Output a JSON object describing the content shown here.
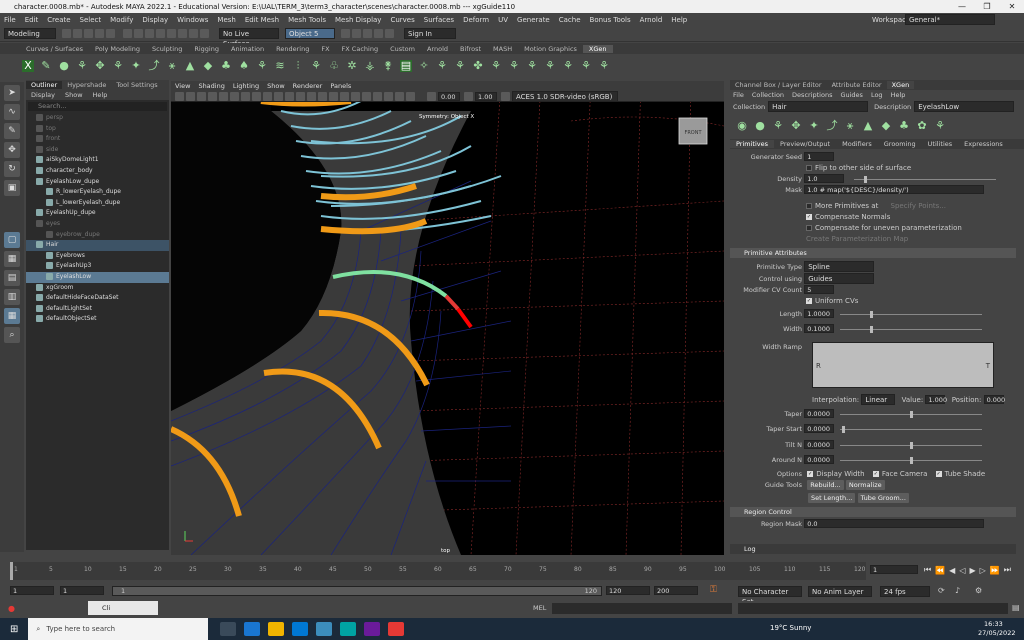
{
  "window": {
    "title": "character.0008.mb* - Autodesk MAYA 2022.1 - Educational Version: E:\\UAL\\TERM_3\\term3_character\\scenes\\character.0008.mb  ---  xgGuide110",
    "min": "—",
    "max": "❐",
    "close": "✕"
  },
  "menubar": [
    "File",
    "Edit",
    "Create",
    "Select",
    "Modify",
    "Display",
    "Windows",
    "Mesh",
    "Edit Mesh",
    "Mesh Tools",
    "Mesh Display",
    "Curves",
    "Surfaces",
    "Deform",
    "UV",
    "Generate",
    "Cache",
    "Bonus Tools",
    "Arnold",
    "Help"
  ],
  "workspace": {
    "label": "Workspace:",
    "value": "General*"
  },
  "statusline": {
    "mode": "Modeling",
    "live": "No Live Surface",
    "object": "Object 5",
    "signin": "Sign In"
  },
  "shelf_tabs": [
    "Curves / Surfaces",
    "Poly Modeling",
    "Sculpting",
    "Rigging",
    "Animation",
    "Rendering",
    "FX",
    "FX Caching",
    "Custom",
    "Arnold",
    "Bifrost",
    "MASH",
    "Motion Graphics",
    "XGen"
  ],
  "shelf_active": "XGen",
  "outliner": {
    "tabs": [
      "Outliner",
      "Hypershade",
      "Tool Settings"
    ],
    "menu": [
      "Display",
      "Show",
      "Help"
    ],
    "search_placeholder": "Search...",
    "rows": [
      {
        "label": "persp",
        "style": "dim",
        "indent": 1
      },
      {
        "label": "top",
        "style": "dim",
        "indent": 1
      },
      {
        "label": "front",
        "style": "dim",
        "indent": 1
      },
      {
        "label": "side",
        "style": "dim",
        "indent": 1
      },
      {
        "label": "aiSkyDomeLight1",
        "style": "",
        "indent": 1
      },
      {
        "label": "character_body",
        "style": "",
        "indent": 1
      },
      {
        "label": "EyelashLow_dupe",
        "style": "",
        "indent": 1
      },
      {
        "label": "R_lowerEyelash_dupe",
        "style": "",
        "indent": 2
      },
      {
        "label": "L_lowerEyelash_dupe",
        "style": "",
        "indent": 2
      },
      {
        "label": "EyelashUp_dupe",
        "style": "",
        "indent": 1
      },
      {
        "label": "eyes",
        "style": "dim",
        "indent": 1
      },
      {
        "label": "eyebrow_dupe",
        "style": "dim",
        "indent": 2
      },
      {
        "label": "Hair",
        "style": "sel2",
        "indent": 1
      },
      {
        "label": "Eyebrows",
        "style": "",
        "indent": 2
      },
      {
        "label": "EyelashUp3",
        "style": "",
        "indent": 2
      },
      {
        "label": "EyelashLow",
        "style": "sel",
        "indent": 2
      },
      {
        "label": "xgGroom",
        "style": "",
        "indent": 1
      },
      {
        "label": "defaultHideFaceDataSet",
        "style": "",
        "indent": 1
      },
      {
        "label": "defaultLightSet",
        "style": "",
        "indent": 1
      },
      {
        "label": "defaultObjectSet",
        "style": "",
        "indent": 1
      }
    ]
  },
  "viewport": {
    "menu": [
      "View",
      "Shading",
      "Lighting",
      "Show",
      "Renderer",
      "Panels"
    ],
    "symmetry": "Symmetry: Object X",
    "camera": "top",
    "cube": "FRONT",
    "val1": "0.00",
    "val2": "1.00",
    "colorspace": "ACES 1.0 SDR-video (sRGB)"
  },
  "right": {
    "tabs": [
      "Channel Box / Layer Editor",
      "Attribute Editor",
      "XGen"
    ],
    "active_tab": "XGen",
    "menu": [
      "File",
      "Collection",
      "Descriptions",
      "Guides",
      "Log",
      "Help"
    ],
    "collection_label": "Collection",
    "collection": "Hair",
    "description_label": "Description",
    "description": "EyelashLow",
    "subtabs": [
      "Primitives",
      "Preview/Output",
      "Modifiers",
      "Grooming",
      "Utilities",
      "Expressions"
    ],
    "generator_seed_label": "Generator Seed",
    "generator_seed": "1",
    "flip_label": "Flip to other side of surface",
    "density_label": "Density",
    "density": "1.0",
    "mask_label": "Mask",
    "mask": "1.0 # map('${DESC}/density/')",
    "more_primitives": "More Primitives at",
    "specify_points": "Specify Points...",
    "compensate_normals": "Compensate Normals",
    "compensate_uneven": "Compensate for uneven parameterization",
    "create_param_map": "Create Parameterization Map",
    "primitive_attributes": "Primitive Attributes",
    "primitive_type_label": "Primitive Type",
    "primitive_type": "Spline",
    "control_using_label": "Control using",
    "control_using": "Guides",
    "modifier_cv_label": "Modifier CV Count",
    "modifier_cv": "5",
    "uniform_cvs": "Uniform CVs",
    "length_label": "Length",
    "length": "1.0000",
    "width_label": "Width",
    "width": "0.1000",
    "width_ramp_label": "Width Ramp",
    "ramp_r": "R",
    "ramp_t": "T",
    "interp_label": "Interpolation:",
    "interp": "Linear",
    "value_label": "Value:",
    "value": "1.000",
    "position_label": "Position:",
    "position": "0.000",
    "taper_label": "Taper",
    "taper": "0.0000",
    "taper_start_label": "Taper Start",
    "taper_start": "0.0000",
    "tilt_label": "Tilt N",
    "tilt": "0.0000",
    "around_label": "Around N",
    "around": "0.0000",
    "options_label": "Options",
    "display_width": "Display Width",
    "face_camera": "Face Camera",
    "tube_shade": "Tube Shade",
    "guide_tools_label": "Guide Tools",
    "rebuild": "Rebuild...",
    "normalize": "Normalize",
    "set_length": "Set Length...",
    "tube_groom": "Tube Groom...",
    "region_control": "Region Control",
    "region_mask_label": "Region Mask",
    "region_mask": "0.0",
    "log": "Log"
  },
  "timeline": {
    "ticks": [
      "1",
      "5",
      "10",
      "15",
      "20",
      "25",
      "30",
      "35",
      "40",
      "45",
      "50",
      "55",
      "60",
      "65",
      "70",
      "75",
      "80",
      "85",
      "90",
      "95",
      "100",
      "105",
      "110",
      "115",
      "120"
    ],
    "current": "1"
  },
  "range": {
    "start": "1",
    "start2": "1",
    "slider_label": "120",
    "end": "120",
    "end2": "200",
    "character": "No Character Set",
    "anim_layer": "No Anim Layer",
    "fps": "24 fps"
  },
  "cmdline": {
    "mel": "MEL",
    "window": "Cli"
  },
  "taskbar": {
    "search": "Type here to search",
    "weather": "19°C  Sunny",
    "time": "16:33",
    "date": "27/05/2022"
  }
}
